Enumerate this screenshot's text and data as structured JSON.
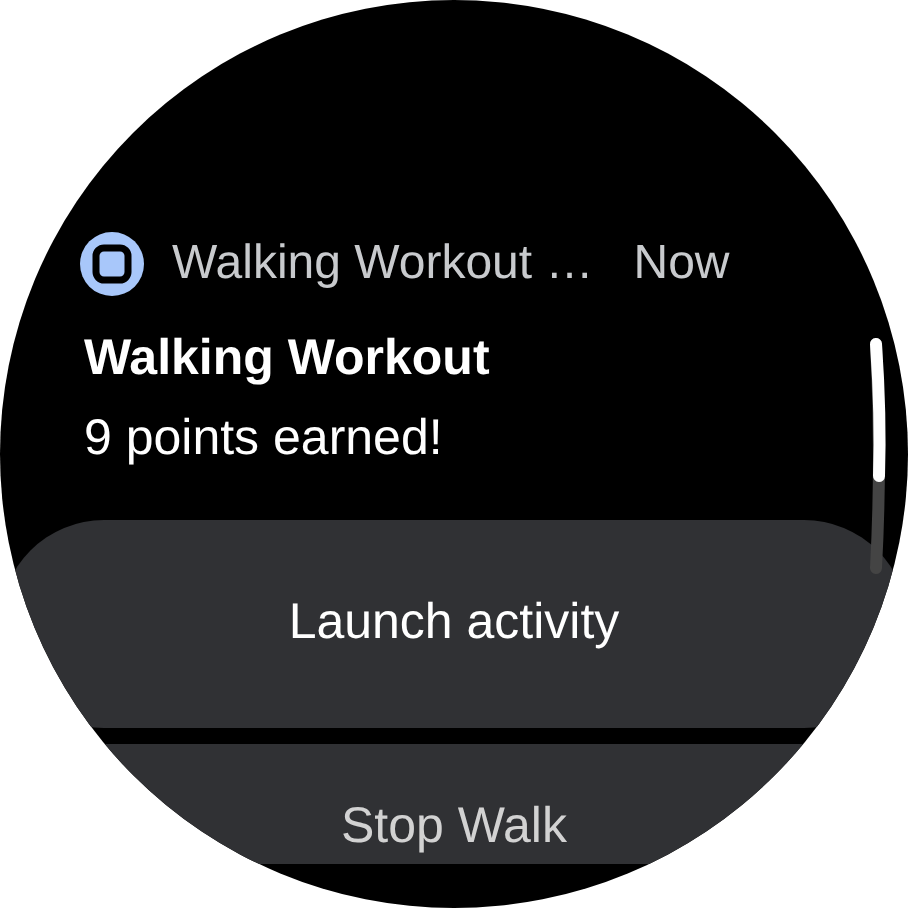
{
  "notification": {
    "app_name": "Walking Workout …",
    "time": "Now",
    "title": "Walking Workout",
    "text": "9 points earned!"
  },
  "actions": [
    {
      "label": "Launch activity"
    },
    {
      "label": "Stop Walk"
    }
  ]
}
